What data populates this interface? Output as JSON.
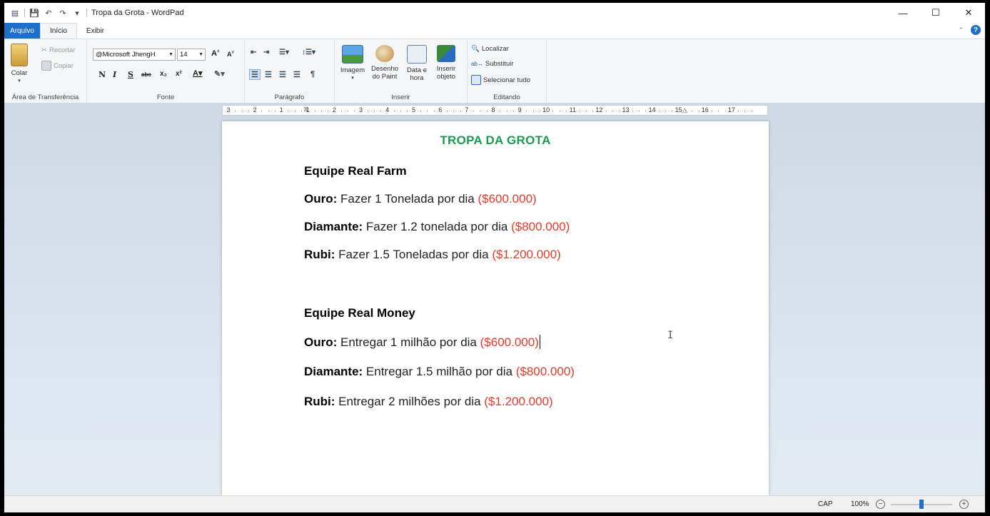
{
  "window": {
    "title": "Tropa da Grota - WordPad",
    "minimize": "—",
    "maximize": "☐",
    "close": "✕"
  },
  "tabs": {
    "file": "Arquivo",
    "home": "Início",
    "view": "Exibir"
  },
  "ribbon": {
    "clipboard": {
      "label": "Área de Transferência",
      "paste": "Colar",
      "cut": "Recortar",
      "copy": "Copiar"
    },
    "font": {
      "label": "Fonte",
      "family": "@Microsoft JhengH",
      "size": "14",
      "bold": "N",
      "italic": "I",
      "underline": "S",
      "strike": "abc"
    },
    "paragraph": {
      "label": "Parágrafo"
    },
    "insert": {
      "label": "Inserir",
      "image": "Imagem",
      "paint_1": "Desenho",
      "paint_2": "do Paint",
      "datetime_1": "Data e",
      "datetime_2": "hora",
      "object_1": "Inserir",
      "object_2": "objeto"
    },
    "editing": {
      "label": "Editando",
      "find": "Localizar",
      "replace": "Substituir",
      "select_all": "Selecionar tudo"
    }
  },
  "ruler": {
    "marks": [
      "3",
      "2",
      "1",
      "1",
      "2",
      "3",
      "4",
      "5",
      "6",
      "7",
      "8",
      "9",
      "10",
      "11",
      "12",
      "13",
      "14",
      "15",
      "16",
      "17"
    ]
  },
  "document": {
    "title": "TROPA DA GROTA",
    "sections": [
      {
        "heading": "Equipe Real Farm",
        "items": [
          {
            "label": "Ouro:",
            "text": " Fazer 1 Tonelada por dia ",
            "price": "($600.000)"
          },
          {
            "label": "Diamante:",
            "text": " Fazer 1.2 tonelada por dia ",
            "price": "($800.000)"
          },
          {
            "label": "Rubi:",
            "text": " Fazer 1.5 Toneladas por dia ",
            "price": "($1.200.000)"
          }
        ]
      },
      {
        "heading": "Equipe Real Money",
        "items": [
          {
            "label": "Ouro:",
            "text": " Entregar 1 milhão por dia ",
            "price": "($600.000)"
          },
          {
            "label": "Diamante:",
            "text": " Entregar 1.5 milhão por dia ",
            "price": "($800.000)"
          },
          {
            "label": "Rubi:",
            "text": " Entregar 2 milhões por dia ",
            "price": "($1.200.000)"
          }
        ]
      }
    ]
  },
  "status": {
    "caps": "CAP",
    "zoom": "100%",
    "zoom_level_percent": 100
  }
}
